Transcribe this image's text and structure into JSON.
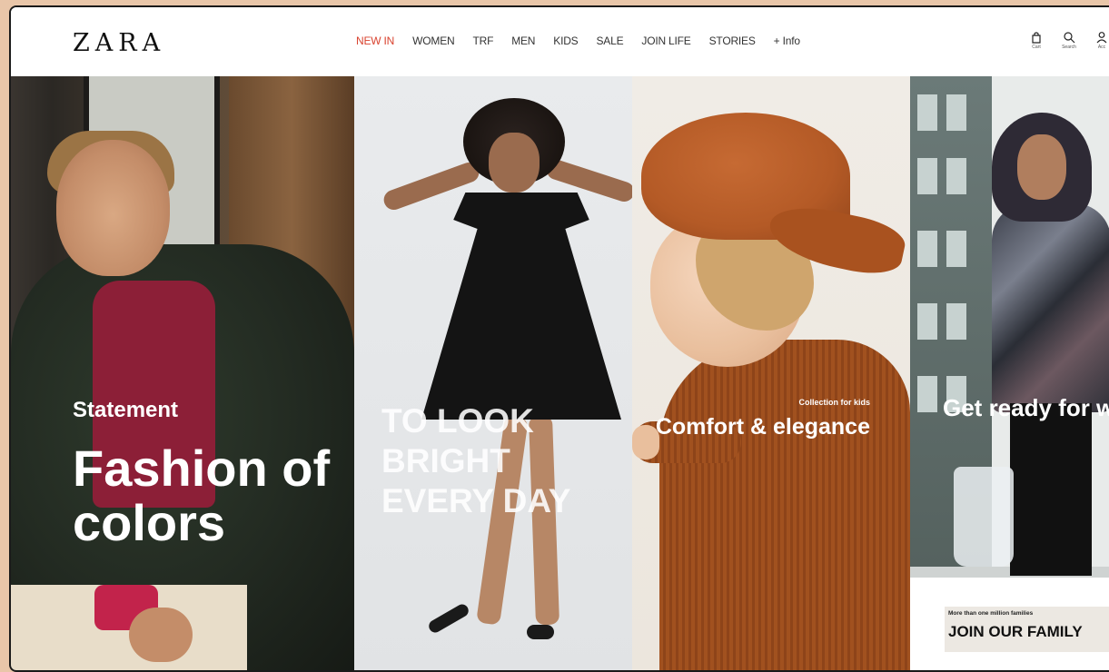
{
  "brand": {
    "logo": "ZARA"
  },
  "nav": {
    "items": [
      {
        "label": "NEW IN",
        "active": true
      },
      {
        "label": "WOMEN"
      },
      {
        "label": "TRF"
      },
      {
        "label": "MEN"
      },
      {
        "label": "KIDS"
      },
      {
        "label": "SALE"
      },
      {
        "label": "JOIN LIFE"
      },
      {
        "label": "STORIES"
      },
      {
        "label": "+ Info"
      }
    ],
    "active_color": "#d9432f"
  },
  "tools": {
    "cart": {
      "label": "Cart",
      "icon": "bag-icon"
    },
    "search": {
      "label": "Search",
      "icon": "search-icon"
    },
    "account": {
      "label": "Acc",
      "icon": "user-icon"
    }
  },
  "panels": {
    "men": {
      "kicker": "Statement",
      "headline": "Fashion of colors"
    },
    "women": {
      "headline": "TO LOOK BRIGHT EVERY DAY"
    },
    "kids": {
      "kicker": "Collection for kids",
      "headline": "Comfort & elegance"
    },
    "trf": {
      "headline": "Get ready for winter",
      "promo_small": "More than one million families",
      "promo_big": "JOIN OUR FAMILY"
    }
  }
}
